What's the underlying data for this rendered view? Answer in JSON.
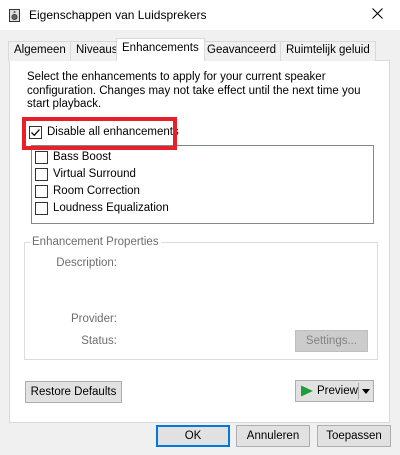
{
  "window": {
    "title": "Eigenschappen van Luidsprekers",
    "close_glyph": "✕"
  },
  "tabs": [
    {
      "label": "Algemeen",
      "active": false
    },
    {
      "label": "Niveaus",
      "active": false
    },
    {
      "label": "Enhancements",
      "active": true
    },
    {
      "label": "Geavanceerd",
      "active": false
    },
    {
      "label": "Ruimtelijk geluid",
      "active": false
    }
  ],
  "enhancements": {
    "description": "Select the enhancements to apply for your current speaker configuration. Changes may not take effect until the next time you start playback.",
    "disable_all": {
      "label": "Disable all enhancements",
      "checked": true
    },
    "items": [
      {
        "label": "Bass Boost",
        "checked": false
      },
      {
        "label": "Virtual Surround",
        "checked": false
      },
      {
        "label": "Room Correction",
        "checked": false
      },
      {
        "label": "Loudness Equalization",
        "checked": false
      }
    ],
    "highlight_color": "#e8202a"
  },
  "properties": {
    "group_label": "Enhancement Properties",
    "description_label": "Description:",
    "provider_label": "Provider:",
    "status_label": "Status:",
    "settings_button": "Settings..."
  },
  "actions": {
    "restore_defaults": "Restore Defaults",
    "preview": "Preview",
    "ok": "OK",
    "cancel": "Annuleren",
    "apply": "Toepassen"
  },
  "colors": {
    "accent": "#0078d7",
    "preview_play": "#1e9e3a"
  }
}
